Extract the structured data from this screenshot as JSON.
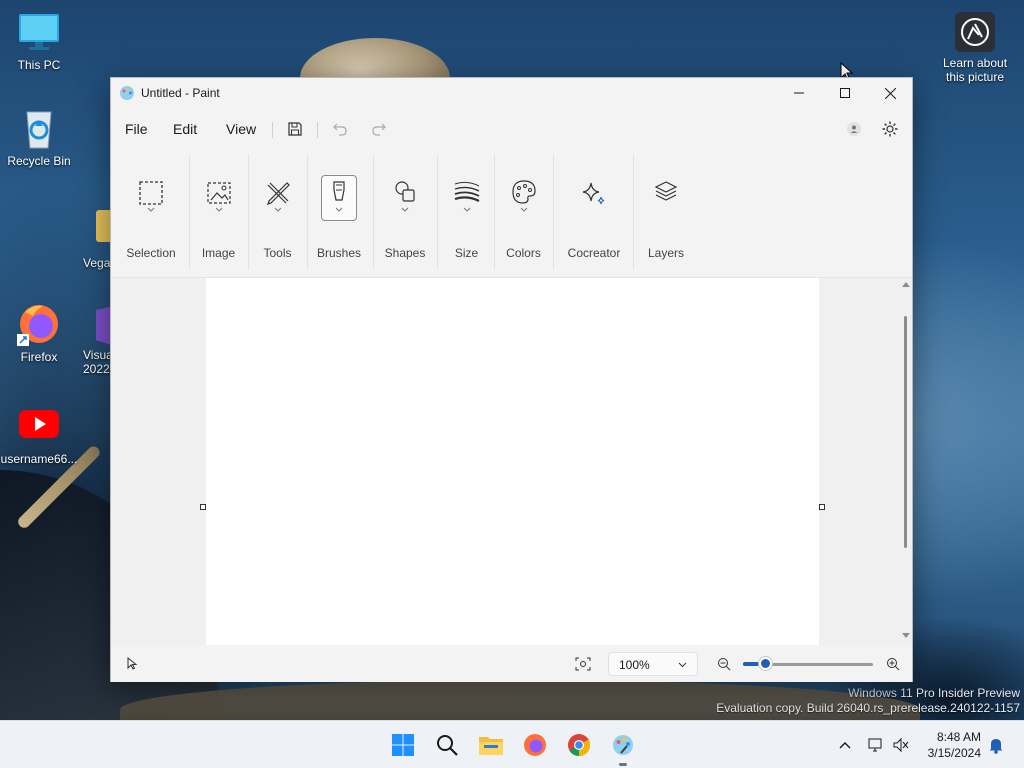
{
  "desktop": {
    "icons": [
      {
        "label": "This PC"
      },
      {
        "label": "Recycle Bin"
      },
      {
        "label": "Vega"
      },
      {
        "label": "Firefox"
      },
      {
        "label": "Visua\n2022"
      },
      {
        "label": "username66..."
      },
      {
        "label": "Learn about\nthis picture"
      }
    ],
    "watermark_line1": "Windows 11 Pro Insider Preview",
    "watermark_line2": "Evaluation copy. Build 26040.rs_prerelease.240122-1157"
  },
  "window": {
    "title": "Untitled - Paint",
    "menu": {
      "file": "File",
      "edit": "Edit",
      "view": "View"
    },
    "ribbon": {
      "selection": "Selection",
      "image": "Image",
      "tools": "Tools",
      "brushes": "Brushes",
      "shapes": "Shapes",
      "size": "Size",
      "colors": "Colors",
      "cocreator": "Cocreator",
      "layers": "Layers"
    },
    "status": {
      "zoom_value": "100%",
      "zoom_slider_level": 0.17
    }
  },
  "taskbar": {
    "time": "8:48 AM",
    "date": "3/15/2024",
    "pinned": [
      "start-icon",
      "search-icon",
      "file-explorer-icon",
      "firefox-icon",
      "chrome-icon",
      "paint-icon"
    ]
  },
  "colors": {
    "accent": "#1f5fb5",
    "youtube_red": "#ff0000",
    "window_bg": "#f3f3f3"
  }
}
